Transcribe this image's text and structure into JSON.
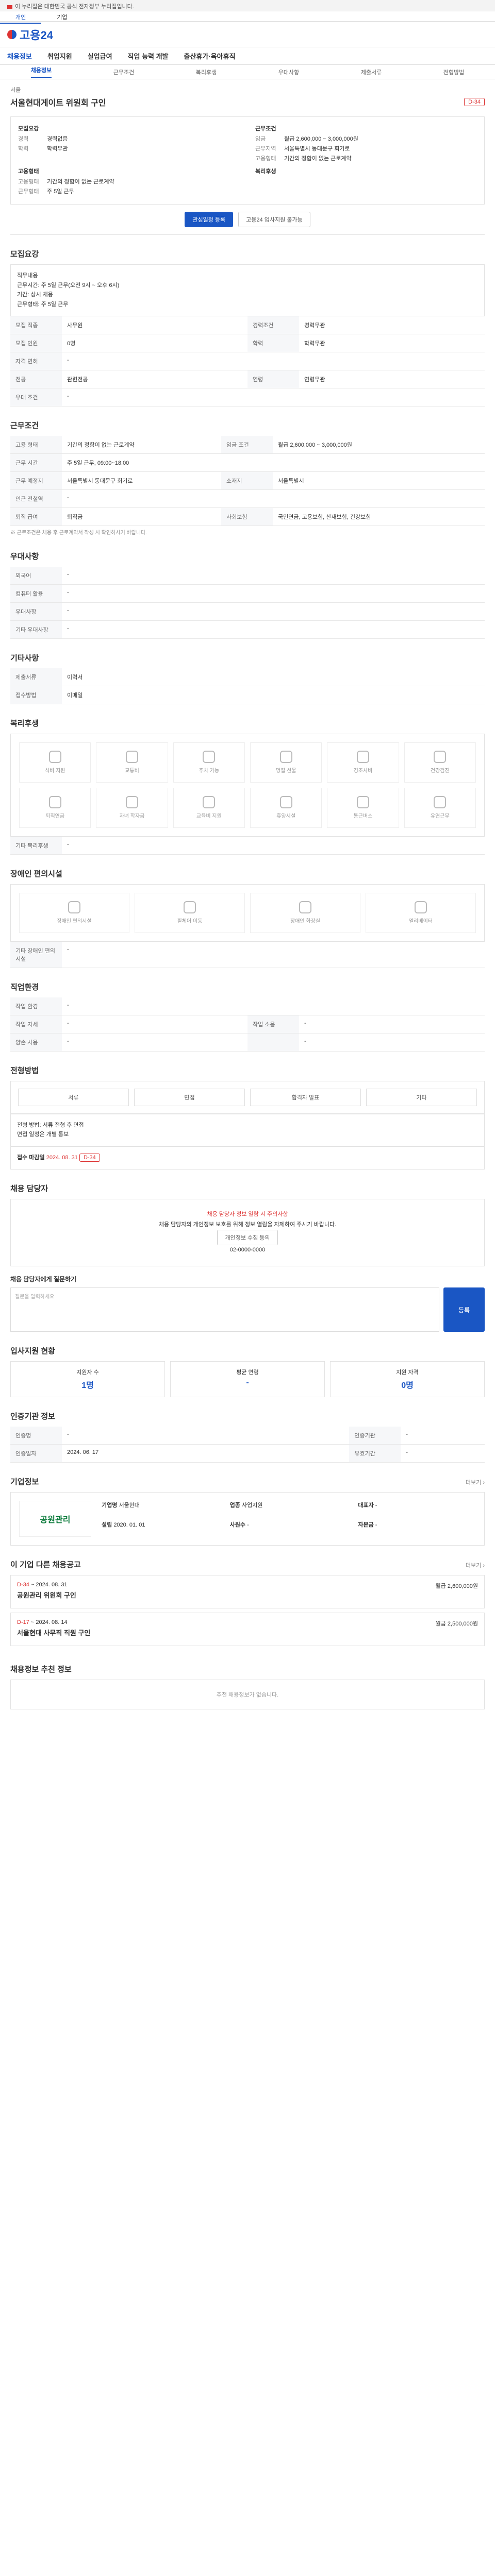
{
  "topbar": {
    "notice": "이 누리집은 대한민국 공식 전자정부 누리집입니다."
  },
  "tabs": [
    "개인",
    "기업"
  ],
  "logo": "고용24",
  "gnb": [
    "채용정보",
    "취업지원",
    "실업급여",
    "직업 능력 개발",
    "출산휴가·육아휴직"
  ],
  "subtabs": [
    "채용정보",
    "근무조건",
    "복리후생",
    "우대사항",
    "제출서류",
    "전형방법"
  ],
  "job": {
    "company": "서울",
    "title": "서울현대게이트 위원회 구인",
    "dday": "D-34"
  },
  "summary": {
    "left_head": "모집요강",
    "right_head": "근무조건",
    "left": [
      [
        "경력",
        "경력없음"
      ],
      [
        "학력",
        "학력무관"
      ]
    ],
    "right": [
      [
        "임금",
        "월급 2,600,000 ~ 3,000,000원"
      ],
      [
        "근무지역",
        "서울특별시 동대문구 회기로"
      ],
      [
        "고용형태",
        "기간의 정함이 없는 근로계약"
      ]
    ],
    "recruit_head": "고용형태",
    "recruit": [
      [
        "고용형태",
        "기간의 정함이 없는 근로계약"
      ],
      [
        "근무형태",
        "주 5일 근무"
      ]
    ],
    "welfare_head": "복리후생"
  },
  "actions": {
    "apply": "관심일정 등록",
    "interest": "고용24 입사지원 불가능"
  },
  "sections": {
    "recruit": "모집요강",
    "conditions": "근무조건",
    "preferences": "우대사항",
    "other": "기타사항",
    "welfare": "복리후생",
    "disability": "장애인 편의시설",
    "enterprise": "직업환경",
    "process": "전형방법",
    "contact": "채용 담당자",
    "apply": "입사지원 현황",
    "institution": "인증기관 정보",
    "company": "기업정보",
    "other_jobs": "이 기업 다른 채용공고",
    "recommended": "채용정보 추천 정보"
  },
  "recruit_box": [
    "직무내용",
    "근무시간: 주 5일 근무(오전 9시 ~ 오후 6시)",
    "기간: 상시 채용",
    "근무형태: 주 5일 근무"
  ],
  "recruit_table": [
    [
      "모집 직종",
      "사무원",
      "경력조건",
      "경력무관"
    ],
    [
      "모집 인원",
      "0명",
      "학력",
      "학력무관"
    ],
    [
      "자격 면허",
      "-",
      "",
      ""
    ],
    [
      "전공",
      "관련전공",
      "연령",
      "연령무관"
    ],
    [
      "우대 조건",
      "-",
      "",
      ""
    ]
  ],
  "cond_table": [
    [
      "고용 형태",
      "기간의 정함이 없는 근로계약",
      "임금 조건",
      "월급 2,600,000 ~ 3,000,000원"
    ],
    [
      "근무 시간",
      "주 5일 근무, 09:00~18:00",
      "",
      ""
    ],
    [
      "근무 예정지",
      "서울특별시 동대문구 회기로",
      "소재지",
      "서울특별시"
    ],
    [
      "인근 전철역",
      "-",
      "",
      ""
    ],
    [
      "퇴직 급여",
      "퇴직금",
      "사회보험",
      "국민연금, 고용보험, 산재보험, 건강보험"
    ]
  ],
  "cond_note": "※ 근로조건은 채용 후 근로계약서 작성 시 확인하시기 바랍니다.",
  "pref_table": [
    [
      "외국어",
      "-"
    ],
    [
      "컴퓨터 활용",
      "-"
    ],
    [
      "우대사항",
      "-"
    ],
    [
      "기타 우대사항",
      "-"
    ]
  ],
  "other_table": [
    [
      "제출서류",
      "이력서"
    ],
    [
      "접수방법",
      "이메일"
    ]
  ],
  "welfare_items": [
    "식비 지원",
    "교통비",
    "주차 가능",
    "명절 선물",
    "경조사비",
    "건강검진",
    "퇴직연금",
    "자녀 학자금",
    "교육비 지원",
    "휴양시설",
    "통근버스",
    "유연근무"
  ],
  "welfare_other": "기타 복리후생",
  "disability_items": [
    "장애인 편의시설",
    "휠체어 이동",
    "장애인 화장실",
    "엘리베이터"
  ],
  "disability_other": "기타 장애인 편의시설",
  "env_table": [
    [
      "작업 환경",
      "-",
      "",
      ""
    ],
    [
      "작업 자세",
      "-",
      "작업 소음",
      "-"
    ],
    [
      "양손 사용",
      "-",
      "",
      "-"
    ]
  ],
  "process_steps": [
    "서류",
    "면접",
    "합격자 발표",
    "기타"
  ],
  "process_box": [
    "전형 방법: 서류 전형 후 면접",
    "면접 일정은 개별 통보"
  ],
  "deadline": {
    "label": "접수 마감일",
    "date": "2024. 08. 31"
  },
  "contact": {
    "notice": "채용 담당자 정보 열람 시 주의사항",
    "line1": "채용 담당자의 개인정보 보호를 위해 정보 열람을 자제하여 주시기 바랍니다.",
    "btn": "개인정보 수집 동의",
    "phone": "02-0000-0000"
  },
  "apply_box": {
    "label": "채용 담당자에게 질문하기",
    "placeholder": "질문을 입력하세요",
    "btn": "등록"
  },
  "apply_stats": [
    [
      "지원자 수",
      "1명"
    ],
    [
      "평균 연령",
      "-"
    ],
    [
      "지원 자격",
      "0명"
    ]
  ],
  "institution": [
    [
      "인증명",
      "-",
      "인증기관",
      "-"
    ],
    [
      "인증일자",
      "2024. 06. 17",
      "유효기간",
      "-"
    ]
  ],
  "company": {
    "logo_text": "공원관리",
    "info": [
      [
        "기업명",
        "서울현대"
      ],
      [
        "업종",
        "사업지원"
      ],
      [
        "대표자",
        "-"
      ],
      [
        "설립",
        "2020. 01. 01"
      ],
      [
        "사원수",
        "-"
      ],
      [
        "자본금",
        "-"
      ]
    ]
  },
  "other_jobs": [
    {
      "dday": "D-34",
      "date": "~ 2024. 08. 31",
      "title": "공원관리 위원회 구인",
      "cond": "월급 2,600,000원"
    },
    {
      "dday": "D-17",
      "date": "~ 2024. 08. 14",
      "title": "서울현대 사무직 직원 구인",
      "cond": "월급 2,500,000원"
    }
  ],
  "recommended_empty": "추천 채용정보가 없습니다."
}
